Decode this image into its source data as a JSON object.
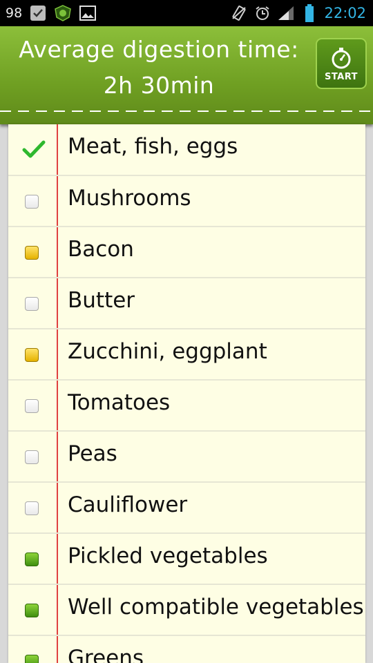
{
  "statusbar": {
    "left_number": "98",
    "time": "22:02",
    "icons": [
      "check-notification-icon",
      "app-badge-icon",
      "image-icon",
      "vibrate-icon",
      "alarm-icon",
      "signal-icon",
      "battery-icon"
    ],
    "time_color": "#33b5e5"
  },
  "header": {
    "title_line1": "Average digestion time:",
    "title_line2": "2h 30min",
    "start_label": "START",
    "accent": "#6f9f22"
  },
  "items": [
    {
      "label": "Meat, fish, eggs",
      "state": "checked"
    },
    {
      "label": "Mushrooms",
      "state": "empty"
    },
    {
      "label": "Bacon",
      "state": "yellow"
    },
    {
      "label": "Butter",
      "state": "empty"
    },
    {
      "label": "Zucchini, eggplant",
      "state": "yellow"
    },
    {
      "label": "Tomatoes",
      "state": "empty"
    },
    {
      "label": "Peas",
      "state": "empty"
    },
    {
      "label": "Cauliflower",
      "state": "empty"
    },
    {
      "label": "Pickled vegetables",
      "state": "green"
    },
    {
      "label": "Well compatible vegetables",
      "state": "green"
    },
    {
      "label": "Greens",
      "state": "green"
    }
  ]
}
